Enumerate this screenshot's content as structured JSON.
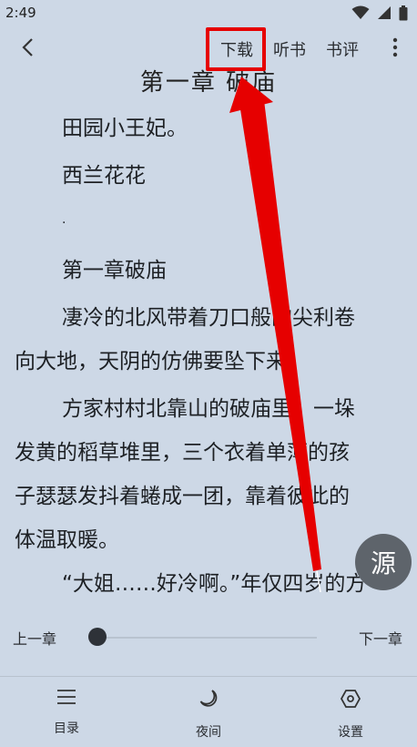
{
  "status_bar": {
    "time": "2:49"
  },
  "app_bar": {
    "download_label": "下载",
    "listen_label": "听书",
    "review_label": "书评"
  },
  "reader": {
    "chapter_heading": "第一章 破庙",
    "lines": [
      "田园小王妃。",
      "西兰花花",
      ".",
      "第一章破庙",
      "凄冷的北风带着刀口般的尖利卷",
      "向大地，天阴的仿佛要坠下来。",
      "方家村村北靠山的破庙里，一垛",
      "发黄的稻草堆里，三个衣着单薄的孩",
      "子瑟瑟发抖着蜷成一团，靠着彼此的",
      "体温取暖。",
      "“大姐……好冷啊。”年仅四岁的方"
    ]
  },
  "source_button": {
    "label": "源"
  },
  "chapter_nav": {
    "prev_label": "上一章",
    "next_label": "下一章",
    "progress": 0
  },
  "bottom_bar": {
    "toc_label": "目录",
    "night_label": "夜间",
    "settings_label": "设置"
  },
  "colors": {
    "background": "#cdd8e6",
    "highlight": "#e60000",
    "fab": "#5e646b"
  }
}
